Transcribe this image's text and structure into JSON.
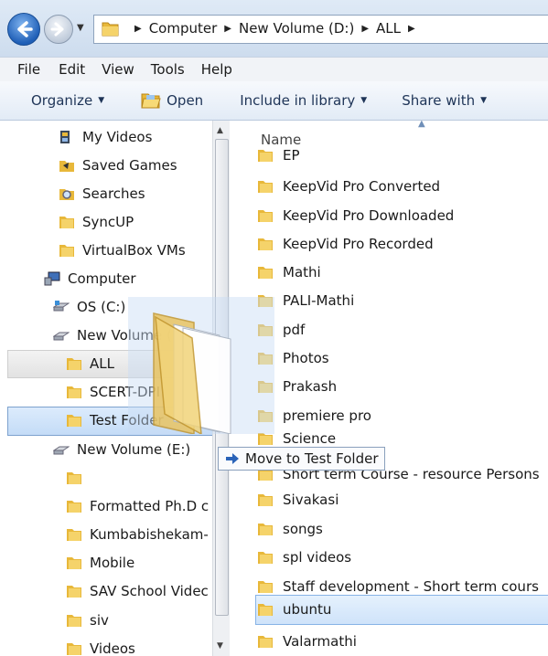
{
  "address_bar": {
    "crumbs": [
      "Computer",
      "New Volume (D:)",
      "ALL"
    ]
  },
  "menu": [
    "File",
    "Edit",
    "View",
    "Tools",
    "Help"
  ],
  "toolbar": {
    "organize": "Organize",
    "open": "Open",
    "include_in_library": "Include in library",
    "share_with": "Share with"
  },
  "nav_pane": {
    "items": [
      {
        "label": "My Videos",
        "icon": "video-library-icon"
      },
      {
        "label": "Saved Games",
        "icon": "saved-games-icon"
      },
      {
        "label": "Searches",
        "icon": "searches-icon"
      },
      {
        "label": "SyncUP",
        "icon": "folder-icon"
      },
      {
        "label": "VirtualBox VMs",
        "icon": "folder-icon"
      },
      {
        "label": "Computer",
        "icon": "computer-icon"
      },
      {
        "label": "OS (C:)",
        "icon": "drive-icon"
      },
      {
        "label": "New Volume (D:)",
        "icon": "drive-icon"
      },
      {
        "label": "ALL",
        "icon": "folder-icon"
      },
      {
        "label": "SCERT-DPI",
        "icon": "folder-icon"
      },
      {
        "label": "Test Folder",
        "icon": "folder-icon"
      },
      {
        "label": "New Volume (E:)",
        "icon": "drive-icon"
      },
      {
        "label": "",
        "icon": "folder-icon"
      },
      {
        "label": "Formatted Ph.D c",
        "icon": "folder-icon"
      },
      {
        "label": "Kumbabishekam-",
        "icon": "folder-icon"
      },
      {
        "label": "Mobile",
        "icon": "folder-icon"
      },
      {
        "label": "SAV School Videc",
        "icon": "folder-icon"
      },
      {
        "label": "siv",
        "icon": "folder-icon"
      },
      {
        "label": "Videos",
        "icon": "folder-icon"
      }
    ]
  },
  "content": {
    "column_name": "Name",
    "items": [
      "EP",
      "KeepVid Pro Converted",
      "KeepVid Pro Downloaded",
      "KeepVid Pro Recorded",
      "Mathi",
      "PALI-Mathi",
      "pdf",
      "Photos",
      "Prakash",
      "premiere pro",
      "Science",
      "Short term Course - resource Persons",
      "Sivakasi",
      "songs",
      "spl videos",
      "Staff development - Short term cours",
      "ubuntu",
      "Valarmathi"
    ],
    "selected": "ubuntu"
  },
  "drag": {
    "tooltip": "Move to Test Folder"
  },
  "colors": {
    "folder": "#e8b83a",
    "selection": "#cfe3fa",
    "accent": "#1f5fb7"
  }
}
